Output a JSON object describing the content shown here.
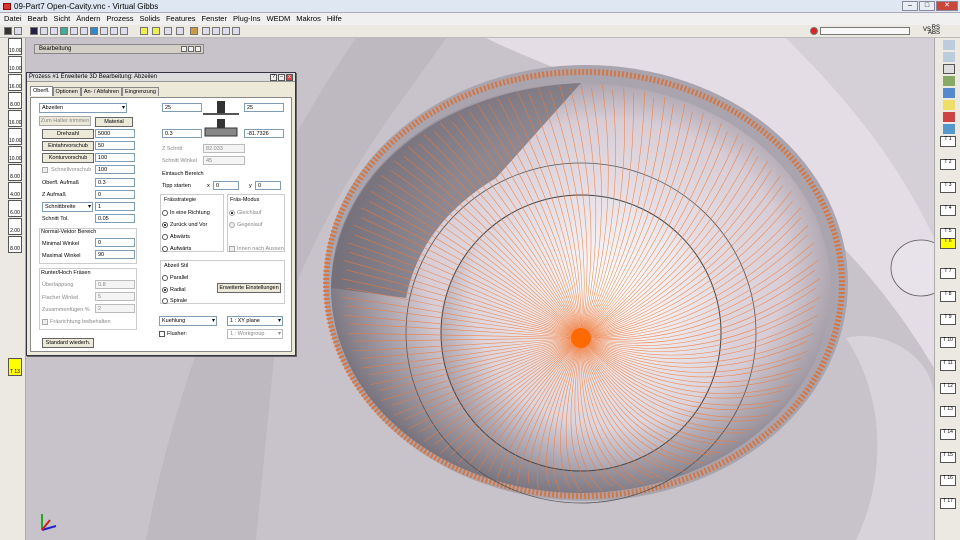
{
  "window": {
    "title": "09-Part7 Open-Cavity.vnc - Virtual Gibbs"
  },
  "menu": [
    "Datei",
    "Bearb",
    "Sicht",
    "Ändern",
    "Prozess",
    "Solids",
    "Features",
    "Fenster",
    "Plug-Ins",
    "WEDM",
    "Makros",
    "Hilfe"
  ],
  "status_right": {
    "line1": "RS",
    "line2": "ABS",
    "line3": "VS"
  },
  "pinbar": {
    "title": "Bearbeitung"
  },
  "left_tools": [
    {
      "label": "10.00"
    },
    {
      "label": "10.00"
    },
    {
      "label": "16.00"
    },
    {
      "label": "8.00"
    },
    {
      "label": "16.00"
    },
    {
      "label": "10.00"
    },
    {
      "label": "10.00"
    },
    {
      "label": "8.00"
    },
    {
      "label": "4.00"
    },
    {
      "label": "6.00"
    },
    {
      "label": "2.00"
    },
    {
      "label": "8.00"
    }
  ],
  "left_tools_extra": {
    "label": "T 13"
  },
  "right_tools": [
    "T 1",
    "T 2",
    "T 3",
    "T 4",
    "T 5",
    "T 6",
    "T 7",
    "T 8",
    "T 9",
    "T 10",
    "T 11",
    "T 12",
    "T 13",
    "T 14",
    "T 15",
    "T 16",
    "T 17"
  ],
  "dialog": {
    "title": "Prozess #1 Erweiterte 3D Bearbeitung: Abzeilen",
    "tabs": [
      "Oberfl.",
      "Optionen",
      "An- / Abfahren",
      "Eingrenzung"
    ],
    "operation": "Abzeilen",
    "zum_halter": "Zum Halter trimmen",
    "material_btn": "Material",
    "rows": [
      {
        "label": "Drehzahl",
        "value": "5000"
      },
      {
        "label": "Eintahrvorschub",
        "value": "50"
      },
      {
        "label": "Konturvorschub",
        "value": "100"
      },
      {
        "label": "Schnellvorschub",
        "value": "100"
      }
    ],
    "oberfl_aufmass": {
      "label": "Oberfl. Aufmaß",
      "value": "0.3"
    },
    "z_aufmass": {
      "label": "Z Aufmaß",
      "value": "0"
    },
    "schnittbreite": {
      "label": "Schnittbreite",
      "value": "1"
    },
    "schnitt_tol": {
      "label": "Schnitt Tol.",
      "value": "0.05"
    },
    "normal_vektor": {
      "title": "Normal-Vektor Bereich",
      "min_label": "Minimal Winkel",
      "min": "0",
      "max_label": "Maximal Winkel",
      "max": "90"
    },
    "runter": {
      "title": "Runter/Hoch Fräsen",
      "ueberlappung_label": "Überlappung",
      "ueberlappung": "0.8",
      "flacher_label": "Flacher Winkel",
      "flacher": "5",
      "zusammen_label": "Zusammenfügen %",
      "zusammen": "2",
      "fraesrichtung": "Fräsrichtung beibehalten"
    },
    "standard_btn": "Standard wiederh.",
    "top_left_val": "25",
    "top_right_val": "25",
    "mid_left_val": "0.3",
    "mid_right_val": "-81.7326",
    "z_schritt": {
      "label": "Z Schritt",
      "value": "82.033"
    },
    "schnitt_winkel": {
      "label": "Schnitt Winkel",
      "value": "45"
    },
    "eintauch": {
      "title": "Eintauch Bereich",
      "tipp": "Tipp starten",
      "x_label": "x",
      "x": "0",
      "y_label": "y",
      "y": "0"
    },
    "fraesstrategie": {
      "title": "Frässtrategie",
      "options": [
        "In eine Richtung",
        "Zurück und Vor",
        "Abwärts",
        "Aufwärts"
      ],
      "selected": 1
    },
    "fraes_modus": {
      "title": "Fräs-Modus",
      "gleichlauf": "Gleichlauf",
      "gegenlauf": "Gegenlauf",
      "innen": "Innen nach Aussen"
    },
    "abzeil_stil": {
      "title": "Abzeil Stil",
      "options": [
        "Parallel",
        "Radial",
        "Spirale"
      ],
      "selected": 1,
      "erweitert_btn": "Erweiterte Einstellungen"
    },
    "kuehlung": "Kuehlung",
    "plane": "1 : XY plane",
    "flusher": "Flusher:",
    "workgroup": "1 : Workgroup"
  }
}
